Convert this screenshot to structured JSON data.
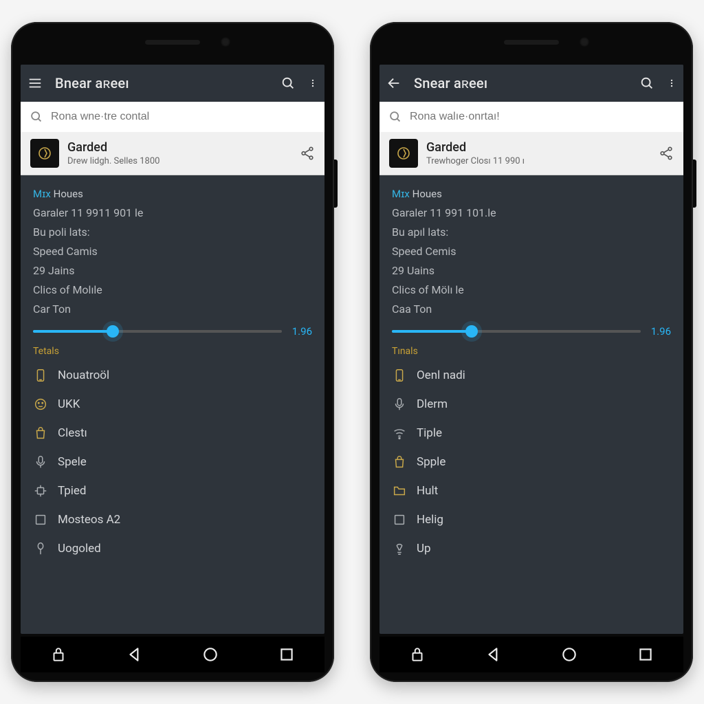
{
  "phones": [
    {
      "appbar": {
        "nav_icon": "menu",
        "title": "Bnear aʀeeı"
      },
      "search": {
        "placeholder": "Rona wne·tre contal"
      },
      "card": {
        "title": "Garded",
        "subtitle": "Drew lidgh. Selles 1800"
      },
      "section": {
        "highlight": "Mɪx",
        "rest": "Houes"
      },
      "lines": [
        "Garaler 11 9911 901 le",
        "Bu poli lats:",
        "Speed Camis",
        "29 Jains",
        "Clics of Molıle",
        "Car Ton"
      ],
      "slider": {
        "percent": 32,
        "value": "1.96"
      },
      "list_header": "Tetals",
      "items": [
        {
          "icon": "device",
          "tone": "accent",
          "label": "Nouatroöl"
        },
        {
          "icon": "face",
          "tone": "accent",
          "label": "UKK"
        },
        {
          "icon": "bag",
          "tone": "accent",
          "label": "Clestı"
        },
        {
          "icon": "mic",
          "tone": "grey",
          "label": "Spele"
        },
        {
          "icon": "chip",
          "tone": "grey",
          "label": "Tpied"
        },
        {
          "icon": "square",
          "tone": "grey",
          "label": "Mosteos A2"
        },
        {
          "icon": "pin",
          "tone": "grey",
          "label": "Uogoled"
        }
      ]
    },
    {
      "appbar": {
        "nav_icon": "back",
        "title": "Snear aʀeeı"
      },
      "search": {
        "placeholder": "Rona walıe·onrtaı!"
      },
      "card": {
        "title": "Garded",
        "subtitle": "Trewhoger Closı 11 990 ı"
      },
      "section": {
        "highlight": "Mɪx",
        "rest": "Houes"
      },
      "lines": [
        "Garaler 11 991 101.le",
        "Bu apıl lats:",
        "Speed Cemis",
        "29 Uains",
        "Clics of Mölı le",
        "Caa Ton"
      ],
      "slider": {
        "percent": 32,
        "value": "1.96"
      },
      "list_header": "Tınals",
      "items": [
        {
          "icon": "device",
          "tone": "accent",
          "label": "Oenl nadi"
        },
        {
          "icon": "mic",
          "tone": "grey",
          "label": "Dlerm"
        },
        {
          "icon": "wifi",
          "tone": "grey",
          "label": "Tiple"
        },
        {
          "icon": "bag",
          "tone": "accent",
          "label": "Spple"
        },
        {
          "icon": "folder",
          "tone": "accent",
          "label": "Hult"
        },
        {
          "icon": "square",
          "tone": "grey",
          "label": "Helig"
        },
        {
          "icon": "bulb",
          "tone": "grey",
          "label": "Up"
        }
      ]
    }
  ],
  "colors": {
    "accent": "#29b6f6",
    "gold": "#c9a84a",
    "bg": "#2e343b"
  }
}
